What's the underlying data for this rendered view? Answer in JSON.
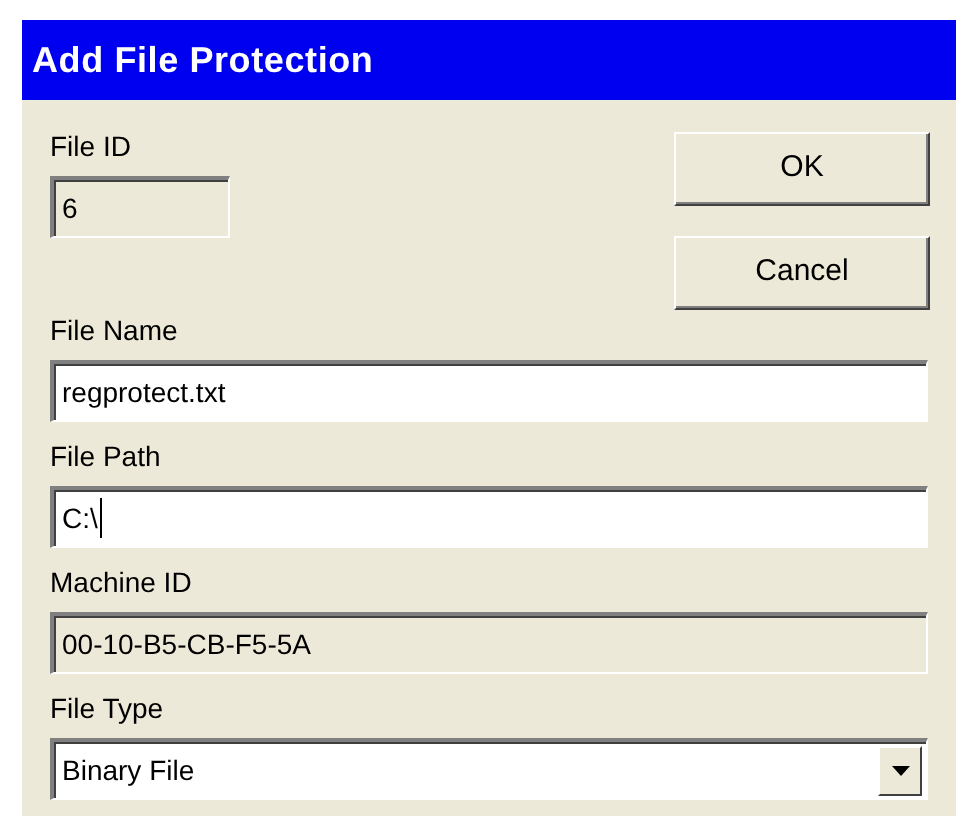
{
  "window": {
    "title": "Add File Protection"
  },
  "buttons": [
    {
      "label": "OK"
    },
    {
      "label": "Cancel"
    }
  ],
  "fields": [
    {
      "kind": "text",
      "label": "File ID",
      "value": "6",
      "readonly": true,
      "focused": false
    },
    {
      "kind": "text",
      "label": "File Name",
      "value": "regprotect.txt",
      "readonly": false,
      "focused": false
    },
    {
      "kind": "text",
      "label": "File Path",
      "value": "C:\\",
      "readonly": false,
      "focused": true
    },
    {
      "kind": "text",
      "label": "Machine ID",
      "value": "00-10-B5-CB-F5-5A",
      "readonly": true,
      "focused": false
    },
    {
      "kind": "select",
      "label": "File Type",
      "value": "Binary File",
      "readonly": false,
      "focused": false
    }
  ]
}
